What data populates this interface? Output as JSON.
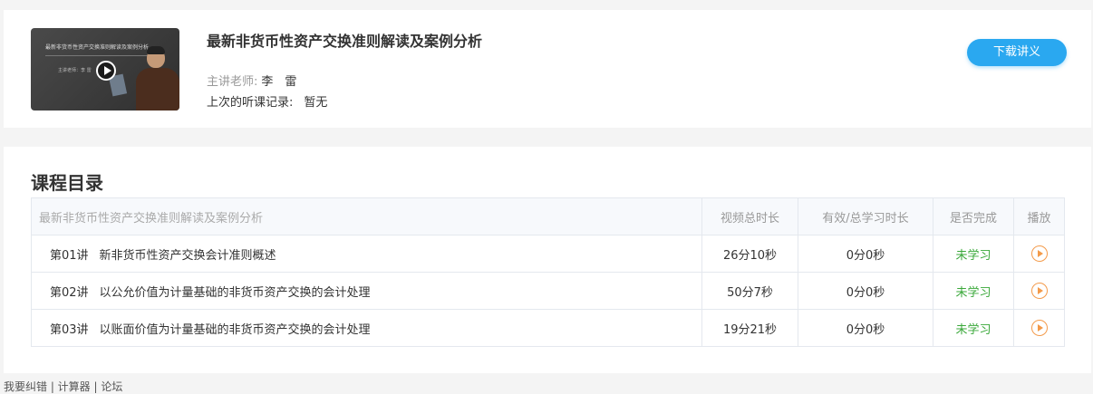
{
  "course": {
    "title": "最新非货币性资产交换准则解读及案例分析",
    "thumbnail_title": "最新非货币性资产交换准则解读及案例分析",
    "thumbnail_subtitle": "主讲老师：李 雷",
    "teacher_label": "主讲老师:",
    "teacher_name": "李　雷",
    "last_record_label": "上次的听课记录:",
    "last_record_value": "暂无",
    "download_label": "下载讲义"
  },
  "catalog": {
    "section_title": "课程目录",
    "headers": {
      "course": "最新非货币性资产交换准则解读及案例分析",
      "duration": "视频总时长",
      "study_time": "有效/总学习时长",
      "completed": "是否完成",
      "play": "播放"
    },
    "rows": [
      {
        "num": "第01讲",
        "title": "新非货币性资产交换会计准则概述",
        "duration": "26分10秒",
        "study_time": "0分0秒",
        "status": "未学习"
      },
      {
        "num": "第02讲",
        "title": "以公允价值为计量基础的非货币资产交换的会计处理",
        "duration": "50分7秒",
        "study_time": "0分0秒",
        "status": "未学习"
      },
      {
        "num": "第03讲",
        "title": "以账面价值为计量基础的非货币资产交换的会计处理",
        "duration": "19分21秒",
        "study_time": "0分0秒",
        "status": "未学习"
      }
    ]
  },
  "footer": {
    "text": "我要纠错 | 计算器 | 论坛"
  },
  "colors": {
    "accent": "#2aa8f0",
    "status_green": "#3aa83a",
    "play_orange": "#f39a4a"
  },
  "icons": {
    "thumbnail_play": "play-circle-icon",
    "row_play": "play-circle-outline-icon"
  }
}
